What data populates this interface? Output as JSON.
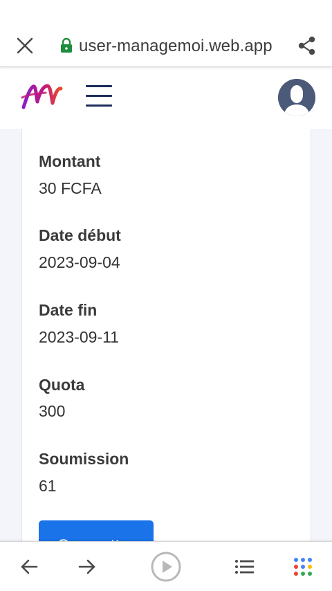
{
  "browser": {
    "url": "user-managemoi.web.app",
    "secure": true
  },
  "details": {
    "fields": [
      {
        "label": "Montant",
        "value": "30 FCFA"
      },
      {
        "label": "Date début",
        "value": "2023-09-04"
      },
      {
        "label": "Date fin",
        "value": "2023-09-11"
      },
      {
        "label": "Quota",
        "value": "300"
      },
      {
        "label": "Soumission",
        "value": "61"
      }
    ],
    "submit_label": "Soumettre"
  },
  "colors": {
    "primary": "#1a73e8",
    "lock": "#1e8e3e",
    "nav_dark": "#1c2b5a",
    "content_bg": "#f3f5fb"
  },
  "icons": {
    "close": "close-icon",
    "lock": "lock-icon",
    "share": "share-icon",
    "menu": "hamburger-menu-icon",
    "avatar": "user-avatar-icon",
    "back": "arrow-left-icon",
    "forward": "arrow-right-icon",
    "play": "play-circle-icon",
    "list": "list-icon",
    "apps": "apps-grid-icon"
  }
}
